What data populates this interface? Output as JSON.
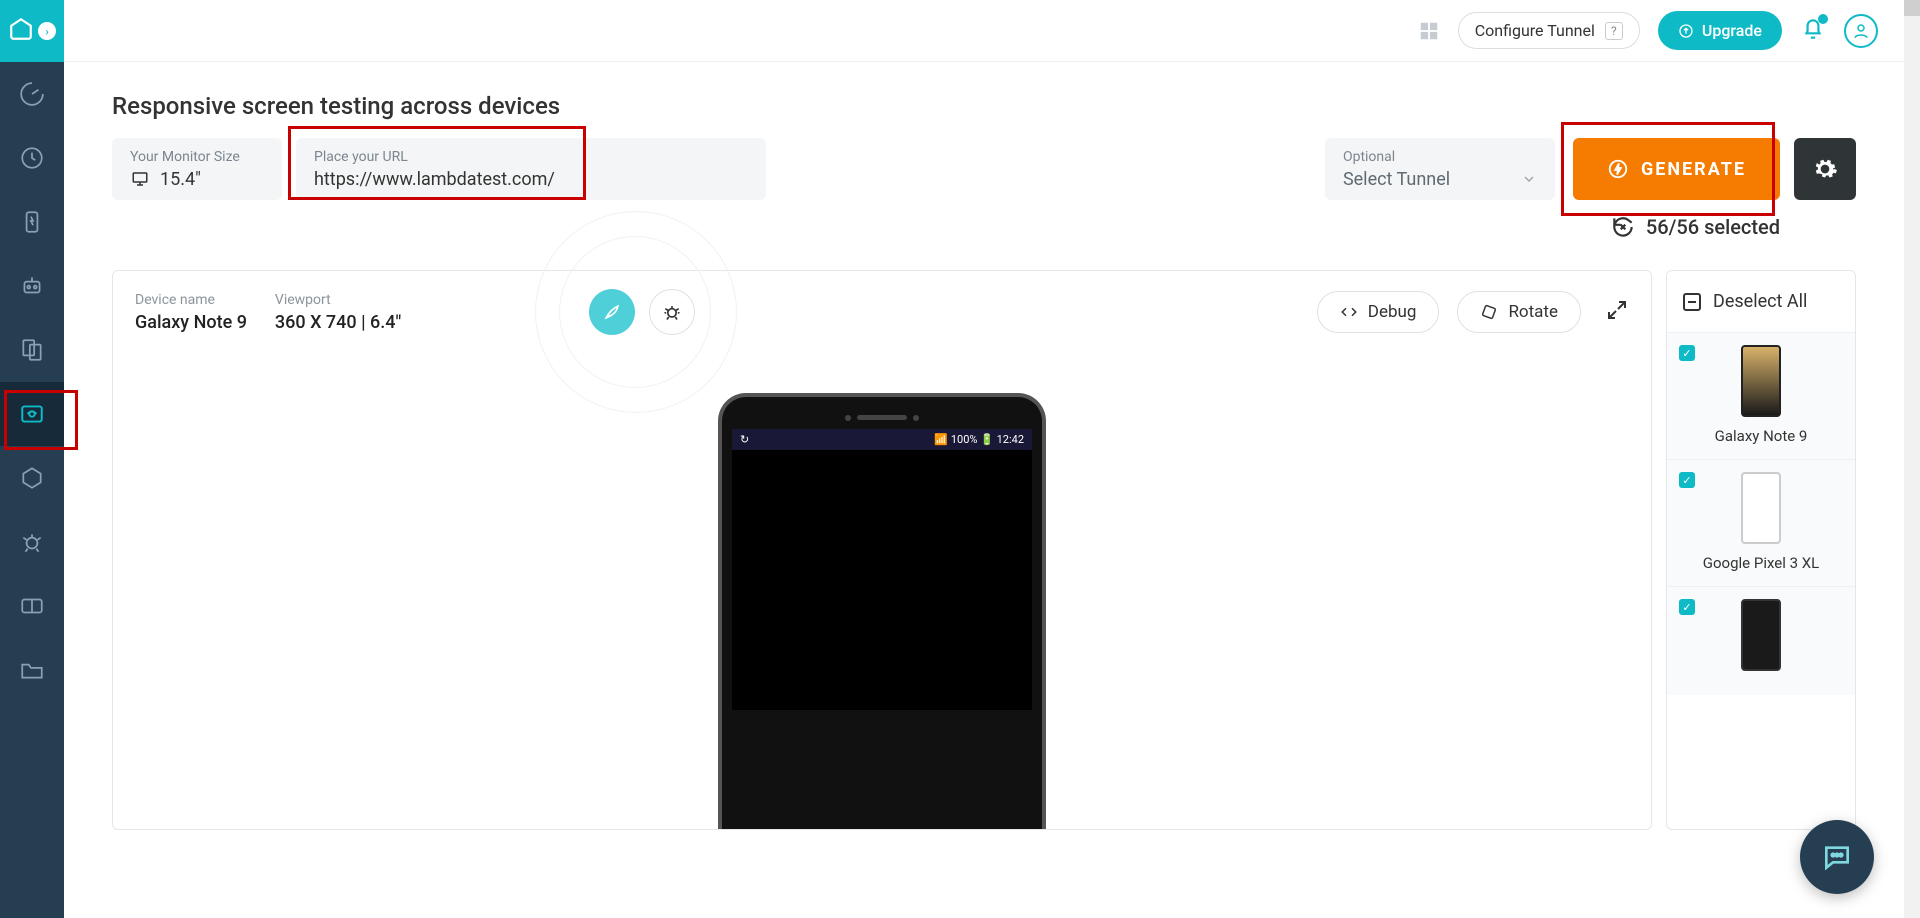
{
  "header": {
    "configure_tunnel": "Configure Tunnel",
    "upgrade": "Upgrade"
  },
  "page_title": "Responsive screen testing across devices",
  "monitor": {
    "label": "Your Monitor Size",
    "value": "15.4\""
  },
  "url": {
    "label": "Place your URL",
    "value": "https://www.lambdatest.com/"
  },
  "tunnel": {
    "label": "Optional",
    "value": "Select Tunnel"
  },
  "generate_label": "GENERATE",
  "selection_status": "56/56 selected",
  "device_preview": {
    "name_label": "Device name",
    "name_value": "Galaxy Note 9",
    "viewport_label": "Viewport",
    "viewport_value": "360 X 740 | 6.4\"",
    "debug": "Debug",
    "rotate": "Rotate",
    "status_bar_left": "↻",
    "status_bar_right": "📶 100% 🔋 12:42"
  },
  "device_list": {
    "deselect": "Deselect All",
    "items": [
      {
        "name": "Galaxy Note 9",
        "checked": true,
        "thumb": "note9"
      },
      {
        "name": "Google Pixel 3 XL",
        "checked": true,
        "thumb": "pixel"
      },
      {
        "name": "",
        "checked": true,
        "thumb": "pixel4"
      }
    ]
  }
}
